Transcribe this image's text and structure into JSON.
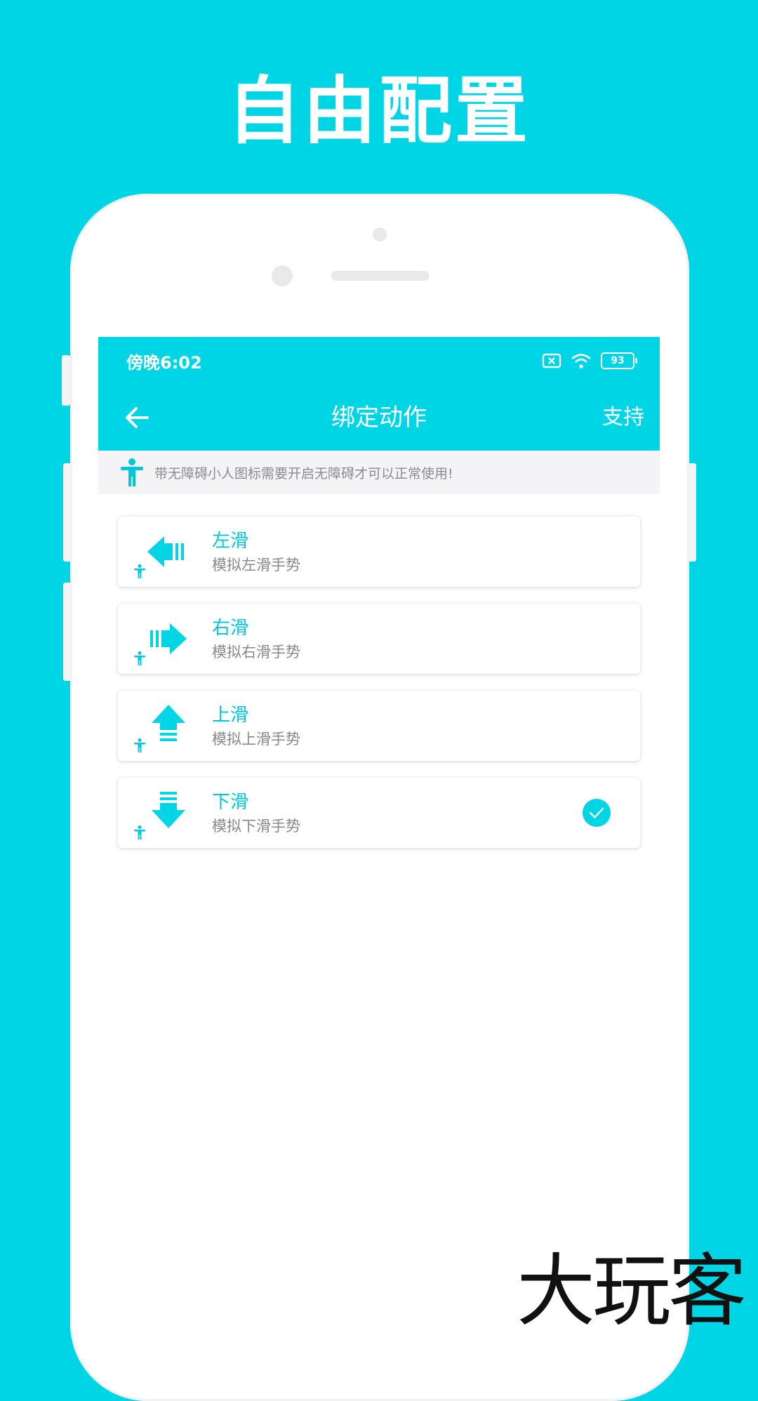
{
  "promo": {
    "title": "自由配置"
  },
  "status_bar": {
    "time": "傍晚6:02",
    "battery": "93"
  },
  "toolbar": {
    "title": "绑定动作",
    "action": "支持"
  },
  "notice": {
    "text": "带无障碍小人图标需要开启无障碍才可以正常使用!"
  },
  "actions": [
    {
      "title": "左滑",
      "subtitle": "模拟左滑手势",
      "icon": "swipe-left-icon",
      "selected": false
    },
    {
      "title": "右滑",
      "subtitle": "模拟右滑手势",
      "icon": "swipe-right-icon",
      "selected": false
    },
    {
      "title": "上滑",
      "subtitle": "模拟上滑手势",
      "icon": "swipe-up-icon",
      "selected": false
    },
    {
      "title": "下滑",
      "subtitle": "模拟下滑手势",
      "icon": "swipe-down-icon",
      "selected": true
    }
  ],
  "watermark": "大玩客",
  "colors": {
    "accent": "#00D5E6",
    "accent_text": "#00C8DA",
    "notice_bg": "#F4F4F6"
  }
}
